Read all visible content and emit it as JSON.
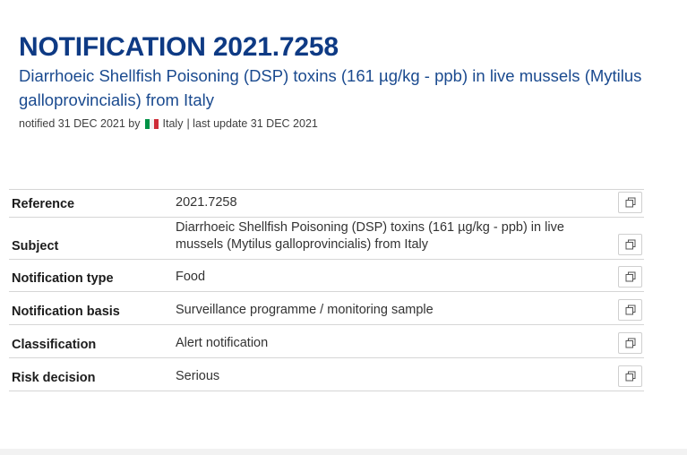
{
  "notification": {
    "title": "NOTIFICATION 2021.7258",
    "subtitle": "Diarrhoeic Shellfish Poisoning (DSP) toxins (161 µg/kg - ppb) in live mussels (Mytilus galloprovincialis) from Italy",
    "notified_prefix": "notified 31 DEC 2021 by",
    "notified_country": "Italy",
    "last_update": "| last update 31 DEC 2021"
  },
  "details": {
    "rows": [
      {
        "label": "Reference",
        "value": "2021.7258",
        "copy_icon": "copy-icon"
      },
      {
        "label": "Subject",
        "value": "Diarrhoeic Shellfish Poisoning (DSP) toxins (161 µg/kg - ppb) in live mussels (Mytilus galloprovincialis) from Italy",
        "copy_icon": "copy-icon"
      },
      {
        "label": "Notification type",
        "value": "Food",
        "copy_icon": "copy-icon"
      },
      {
        "label": "Notification basis",
        "value": "Surveillance programme / monitoring sample",
        "copy_icon": "copy-icon"
      },
      {
        "label": "Classification",
        "value": "Alert notification",
        "copy_icon": "copy-icon"
      },
      {
        "label": "Risk decision",
        "value": "Serious",
        "copy_icon": "copy-icon"
      }
    ]
  },
  "colors": {
    "title": "#0e3a84",
    "subtitle": "#1a4a8f",
    "flag_green": "#009246",
    "flag_white": "#f1f1f1",
    "flag_red": "#ce2b37"
  }
}
